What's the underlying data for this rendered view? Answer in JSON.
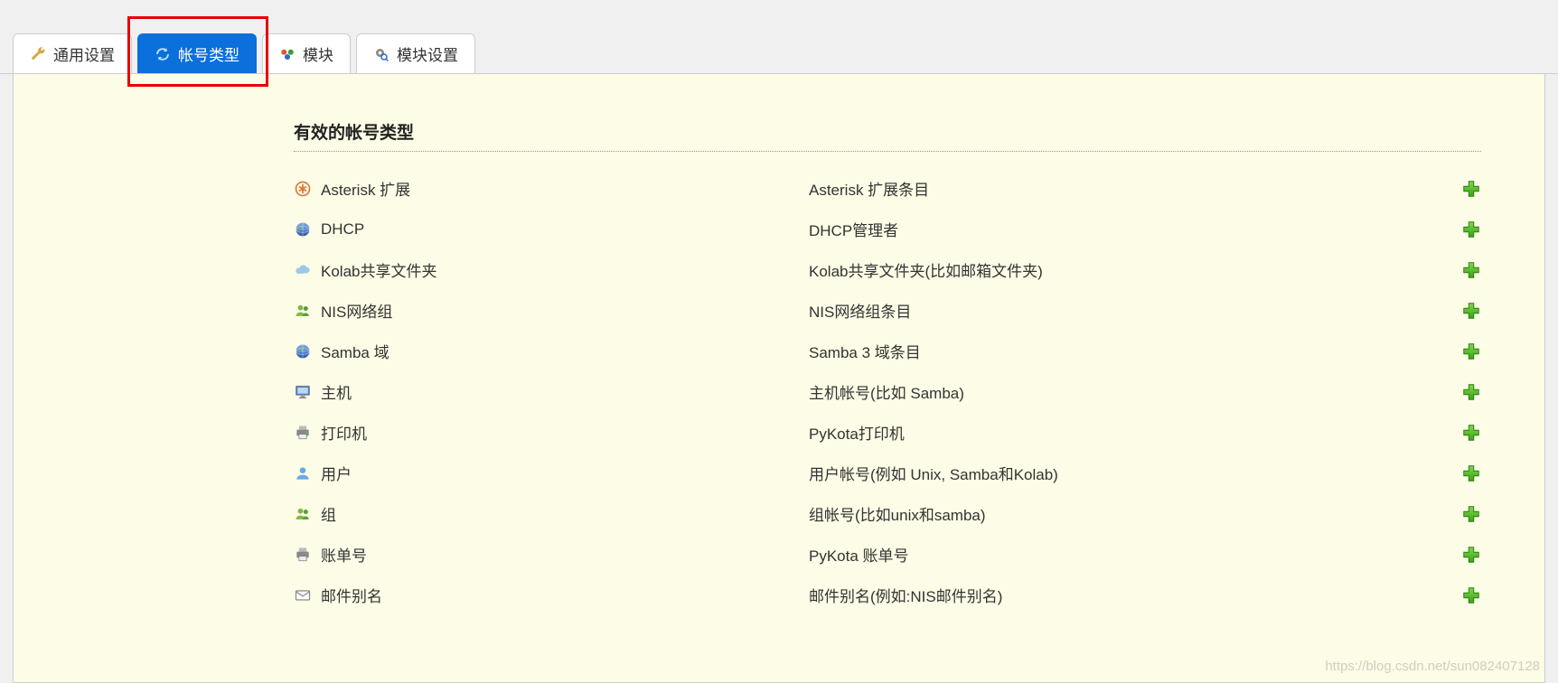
{
  "tabs": [
    {
      "label": "通用设置",
      "active": false,
      "icon": "wrench"
    },
    {
      "label": "帐号类型",
      "active": true,
      "icon": "refresh"
    },
    {
      "label": "模块",
      "active": false,
      "icon": "cubes"
    },
    {
      "label": "模块设置",
      "active": false,
      "icon": "gear-search"
    }
  ],
  "section_title": "有效的帐号类型",
  "account_types": [
    {
      "icon": "asterisk",
      "name": "Asterisk 扩展",
      "desc": "Asterisk 扩展条目"
    },
    {
      "icon": "globe",
      "name": "DHCP",
      "desc": "DHCP管理者"
    },
    {
      "icon": "cloud",
      "name": "Kolab共享文件夹",
      "desc": "Kolab共享文件夹(比如邮箱文件夹)"
    },
    {
      "icon": "users",
      "name": "NIS网络组",
      "desc": "NIS网络组条目"
    },
    {
      "icon": "globe",
      "name": "Samba 域",
      "desc": "Samba 3 域条目"
    },
    {
      "icon": "monitor",
      "name": "主机",
      "desc": "主机帐号(比如 Samba)"
    },
    {
      "icon": "printer",
      "name": "打印机",
      "desc": "PyKota打印机"
    },
    {
      "icon": "user",
      "name": "用户",
      "desc": "用户帐号(例如 Unix, Samba和Kolab)"
    },
    {
      "icon": "users",
      "name": "组",
      "desc": "组帐号(比如unix和samba)"
    },
    {
      "icon": "printer",
      "name": "账单号",
      "desc": "PyKota 账单号"
    },
    {
      "icon": "mail",
      "name": "邮件别名",
      "desc": "邮件别名(例如:NIS邮件别名)"
    }
  ],
  "watermark": "https://blog.csdn.net/sun082407128"
}
